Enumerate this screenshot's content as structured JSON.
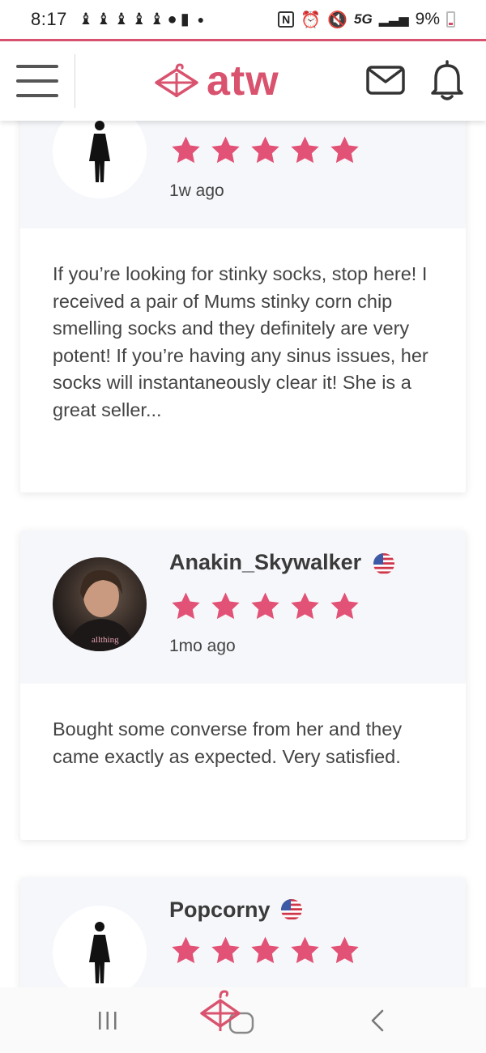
{
  "status_bar": {
    "time": "8:17",
    "network": "5G",
    "battery": "9%",
    "notification_icons": [
      "snapchat-icon",
      "snapchat-icon",
      "snapchat-icon",
      "snapchat-icon",
      "snapchat-icon",
      "chat-icon",
      "alert-icon"
    ],
    "status_icons": [
      "nfc-icon",
      "alarm-icon",
      "mute-icon",
      "signal-icon",
      "battery-icon"
    ]
  },
  "header": {
    "logo_text": "atw",
    "icons": [
      "menu-icon",
      "hanger-logo-icon",
      "mail-icon",
      "bell-icon"
    ]
  },
  "colors": {
    "accent": "#d9536f",
    "star": "#e25276",
    "card_head_bg": "#f6f7fa"
  },
  "reviews": [
    {
      "name": "",
      "avatar": "female-silhouette-icon",
      "rating": 5,
      "time_ago": "1w ago",
      "text": "If you’re looking for stinky socks, stop here! I received a pair of Mums stinky corn chip smelling socks and they definitely are very potent! If you’re having any sinus issues, her socks will instantaneously clear it! She is a great seller..."
    },
    {
      "name": "Anakin_Skywalker",
      "avatar": "user-photo",
      "avatar_watermark": "allthing",
      "flag": "us-flag-icon",
      "rating": 5,
      "time_ago": "1mo ago",
      "text": "Bought some converse from her and they came exactly as expected. Very satisfied."
    },
    {
      "name": "Popcorny",
      "avatar": "female-silhouette-icon",
      "flag": "us-flag-icon",
      "rating": 5,
      "time_ago": "",
      "text": ""
    }
  ],
  "nav_bar": {
    "buttons": [
      "recents-button",
      "home-button",
      "back-button"
    ]
  }
}
